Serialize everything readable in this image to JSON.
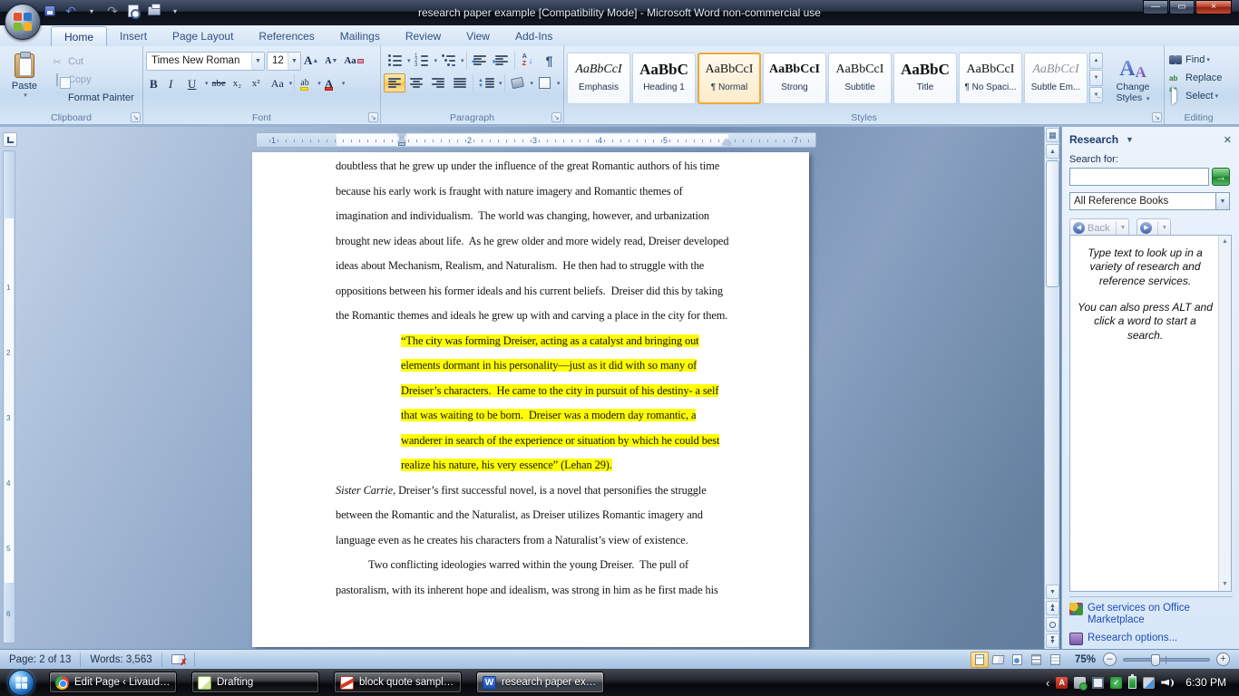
{
  "window": {
    "title": "research paper example [Compatibility Mode]  -  Microsoft Word non-commercial use"
  },
  "ribbon": {
    "tabs": [
      {
        "label": "Home",
        "active": true
      },
      {
        "label": "Insert"
      },
      {
        "label": "Page Layout"
      },
      {
        "label": "References"
      },
      {
        "label": "Mailings"
      },
      {
        "label": "Review"
      },
      {
        "label": "View"
      },
      {
        "label": "Add-Ins"
      }
    ],
    "clipboard": {
      "label": "Clipboard",
      "paste": "Paste",
      "cut": "Cut",
      "copy": "Copy",
      "format_painter": "Format Painter"
    },
    "font": {
      "label": "Font",
      "name": "Times New Roman",
      "size": "12",
      "bold": "B",
      "italic": "I",
      "underline": "U",
      "strike": "abe",
      "subscript": "x₂",
      "superscript": "x²",
      "change_case": "Aa",
      "grow": "A",
      "shrink": "A",
      "clear": "Aa",
      "highlight": "ab",
      "font_color": "A"
    },
    "paragraph": {
      "label": "Paragraph",
      "sort_a": "A",
      "sort_z": "Z",
      "pilcrow": "¶"
    },
    "styles": {
      "label": "Styles",
      "items": [
        {
          "preview": "AaBbCcI",
          "name": "Emphasis",
          "kind": "italic"
        },
        {
          "preview": "AaBbC",
          "name": "Heading 1",
          "kind": "big"
        },
        {
          "preview": "AaBbCcI",
          "name": "¶ Normal",
          "kind": "normal",
          "selected": true
        },
        {
          "preview": "AaBbCcI",
          "name": "Strong",
          "kind": "bold"
        },
        {
          "preview": "AaBbCcI",
          "name": "Subtitle",
          "kind": "normal"
        },
        {
          "preview": "AaBbC",
          "name": "Title",
          "kind": "big"
        },
        {
          "preview": "AaBbCcI",
          "name": "¶ No Spaci...",
          "kind": "normal"
        },
        {
          "preview": "AaBbCcI",
          "name": "Subtle Em...",
          "kind": "gray-italic"
        }
      ]
    },
    "change_styles": {
      "label": "Change Styles",
      "icon_letter": "A"
    },
    "editing": {
      "label": "Editing",
      "find": "Find",
      "replace": "Replace",
      "select": "Select"
    }
  },
  "ruler": {
    "h_numbers": [
      "1",
      "2",
      "3",
      "4",
      "5",
      "7"
    ],
    "v_numbers": [
      "1",
      "2",
      "3",
      "4",
      "5",
      "6"
    ]
  },
  "document": {
    "lines": [
      {
        "k": "b",
        "t": "doubtless that he grew up under the influence of the great Romantic authors of his time"
      },
      {
        "k": "b",
        "t": "because his early work is fraught with nature imagery and Romantic themes of"
      },
      {
        "k": "b",
        "t": "imagination and individualism.  The world was changing, however, and urbanization"
      },
      {
        "k": "b",
        "t": "brought new ideas about life.  As he grew older and more widely read, Dreiser developed"
      },
      {
        "k": "b",
        "t": "ideas about Mechanism, Realism, and Naturalism.  He then had to struggle with the"
      },
      {
        "k": "b",
        "t": "oppositions between his former ideals and his current beliefs.  Dreiser did this by taking"
      },
      {
        "k": "b",
        "t": "the Romantic themes and ideals he grew up with and carving a place in the city for them."
      },
      {
        "k": "q",
        "t": "“The city was forming Dreiser, acting as a catalyst and bringing out"
      },
      {
        "k": "q",
        "t": "elements dormant in his personality—just as it did with so many of"
      },
      {
        "k": "q",
        "t": "Dreiser’s characters.  He came to the city in pursuit of his destiny- a self"
      },
      {
        "k": "q",
        "t": "that was waiting to be born.  Dreiser was a modern day romantic, a"
      },
      {
        "k": "q",
        "t": "wanderer in search of the experience or situation by which he could best"
      },
      {
        "k": "q",
        "t": "realize his nature, his very essence” (Lehan 29)."
      },
      {
        "k": "b",
        "i": "Sister Carrie,",
        "t": " Dreiser’s first successful novel, is a novel that personifies the struggle"
      },
      {
        "k": "b",
        "t": "between the Romantic and the Naturalist, as Dreiser utilizes Romantic imagery and"
      },
      {
        "k": "b",
        "t": "language even as he creates his characters from a Naturalist’s view of existence."
      },
      {
        "k": "bi",
        "t": "Two conflicting ideologies warred within the young Dreiser.  The pull of"
      },
      {
        "k": "b",
        "t": "pastoralism, with its inherent hope and idealism, was strong in him as he first made his"
      }
    ]
  },
  "research": {
    "title": "Research",
    "search_label": "Search for:",
    "search_value": "",
    "source": "All Reference Books",
    "back_label": "Back",
    "tip1": "Type text to look up in a variety of research and reference services.",
    "tip2": "You can also press ALT and click a word to start a search.",
    "services_link": "Get services on Office Marketplace",
    "options_link": "Research options..."
  },
  "status": {
    "page": "Page: 2 of 13",
    "words": "Words: 3,563",
    "zoom": "75%"
  },
  "taskbar": {
    "buttons": [
      {
        "label": "Edit Page ‹ Livaudai...",
        "icon": "chrome"
      },
      {
        "label": "Drafting",
        "icon": "notes"
      },
      {
        "label": "block quote sample ...",
        "icon": "paint"
      },
      {
        "label": "research paper exa...",
        "icon": "word",
        "active": true
      }
    ],
    "clock": "6:30 PM"
  }
}
